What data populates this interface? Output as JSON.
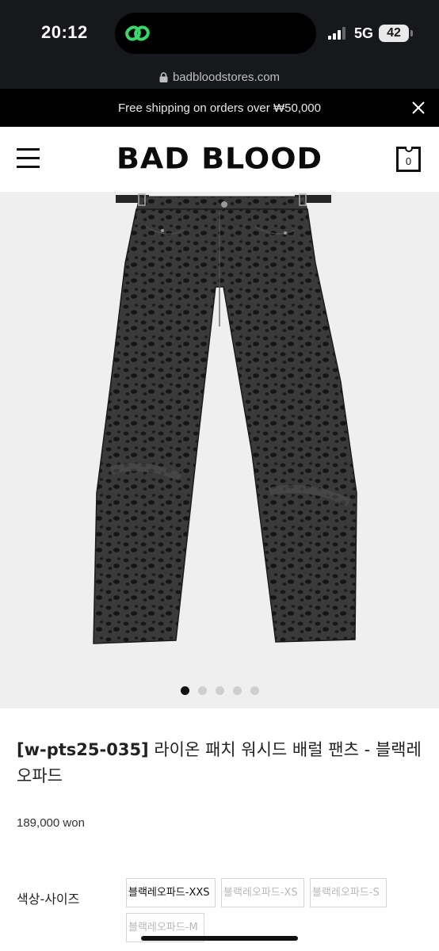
{
  "status_bar": {
    "time": "20:12",
    "network": "5G",
    "battery": "42"
  },
  "browser": {
    "url": "badbloodstores.com"
  },
  "promo": {
    "text": "Free shipping on orders over ₩50,000"
  },
  "header": {
    "logo": "BAD BLOOD",
    "cart_count": "0"
  },
  "gallery": {
    "slide_count": 5,
    "active_index": 0
  },
  "product": {
    "code": "[w-pts25-035]",
    "name": " 라이온 패치 워시드 배럴 팬츠 - 블랙레오파드",
    "price": "189,000 won",
    "option_label": "색상-사이즈",
    "options": [
      {
        "label": "블랙레오파드-XXS",
        "available": true
      },
      {
        "label": "블랙레오파드-XS",
        "available": false
      },
      {
        "label": "블랙레오파드-S",
        "available": false
      },
      {
        "label": "블랙레오파드-M",
        "available": false
      }
    ]
  },
  "colors": {
    "status_bar_bg": "#16181b",
    "promo_bg": "#000000",
    "image_bg": "#efefef",
    "accent_green": "#3bd66b"
  },
  "icons": [
    "lock-icon",
    "close-icon",
    "hamburger-menu-icon",
    "shopping-bag-icon"
  ]
}
